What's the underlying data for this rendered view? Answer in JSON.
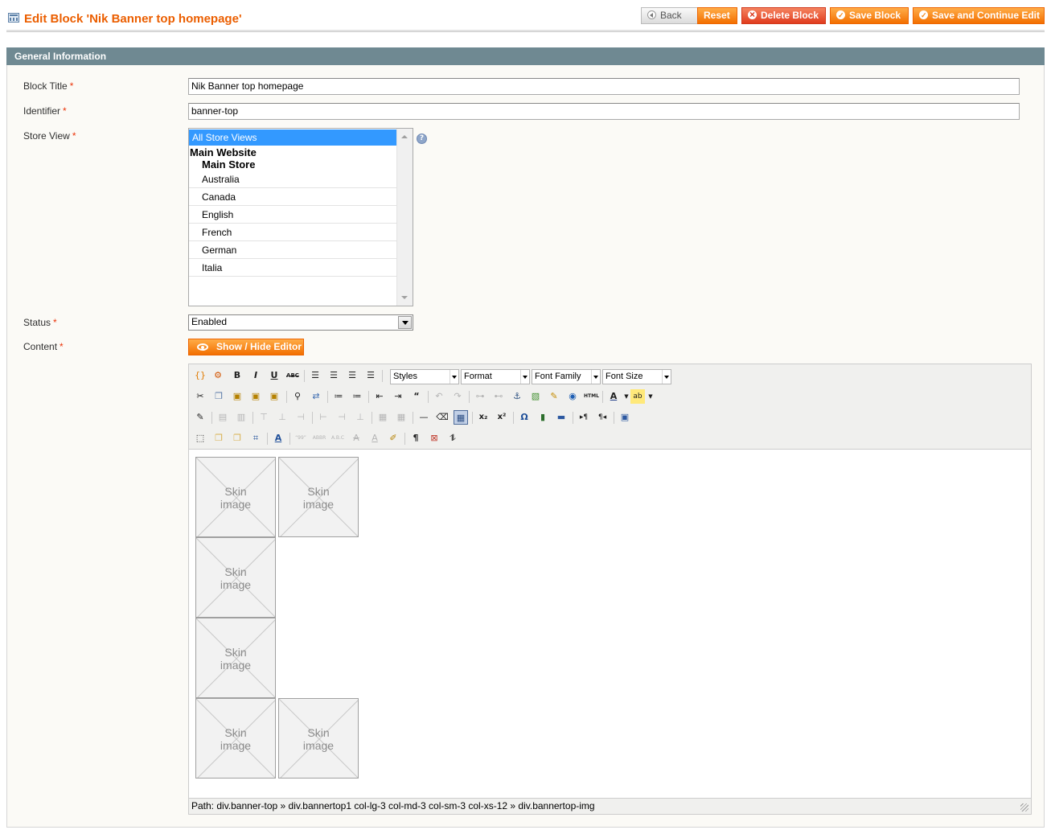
{
  "header": {
    "title": "Edit Block 'Nik Banner top homepage'",
    "buttons": {
      "back": "Back",
      "reset": "Reset",
      "delete": "Delete Block",
      "save": "Save Block",
      "save_continue": "Save and Continue Edit"
    }
  },
  "fieldset": {
    "title": "General Information",
    "required_mark": "*",
    "block_title": {
      "label": "Block Title",
      "value": "Nik Banner top homepage"
    },
    "identifier": {
      "label": "Identifier",
      "value": "banner-top"
    },
    "store_view": {
      "label": "Store View",
      "selected": "All Store Views",
      "website": "Main Website",
      "store": "Main Store",
      "views": [
        "Australia",
        "Canada",
        "English",
        "French",
        "German",
        "Italia"
      ]
    },
    "status": {
      "label": "Status",
      "value": "Enabled"
    },
    "content": {
      "label": "Content",
      "toggle_button": "Show / Hide Editor"
    }
  },
  "editor": {
    "dropdowns": [
      "Styles",
      "Format",
      "Font Family",
      "Font Size"
    ],
    "placeholder_text": "Skin image",
    "path": "Path: div.banner-top » div.bannertop1 col-lg-3 col-md-3 col-sm-3 col-xs-12 » div.bannertop-img"
  }
}
